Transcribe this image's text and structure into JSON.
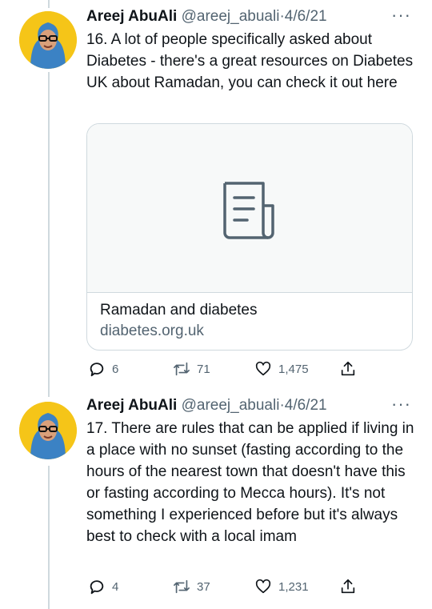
{
  "tweets": [
    {
      "name": "Areej AbuAli",
      "handle": "@areej_abuali",
      "dot": "·",
      "date": "4/6/21",
      "more": "···",
      "text": "16. A lot of people specifically asked about Diabetes - there's a great resources on Diabetes UK about Ramadan, you can check it out here",
      "card": {
        "title": "Ramadan and diabetes",
        "domain": "diabetes.org.uk"
      },
      "stats": {
        "replies": "6",
        "retweets": "71",
        "likes": "1,475"
      }
    },
    {
      "name": "Areej AbuAli",
      "handle": "@areej_abuali",
      "dot": "·",
      "date": "4/6/21",
      "more": "···",
      "text": "17. There are rules that can be applied if living in a place with no sunset (fasting according to the hours of the nearest town that doesn't have this or fasting according to Mecca hours). It's not something I experienced before but it's always best to check with a local imam",
      "stats": {
        "replies": "4",
        "retweets": "37",
        "likes": "1,231"
      }
    }
  ],
  "icons": {
    "reply": "reply-icon",
    "retweet": "retweet-icon",
    "like": "heart-icon",
    "share": "share-icon",
    "card": "document-icon"
  },
  "colors": {
    "text": "#0f1419",
    "secondary": "#536471",
    "border": "#cfd9de",
    "avatar_bg": "#f5c518",
    "hijab": "#3b82c4"
  }
}
